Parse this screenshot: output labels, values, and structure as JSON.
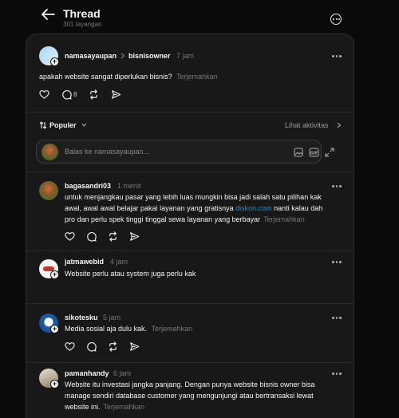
{
  "header": {
    "title": "Thread",
    "views": "301 tayangan"
  },
  "post": {
    "author": "namasayaupan",
    "reply_to": "bisnisowner",
    "time": "7 jam",
    "text": "apakah website sangat diperlukan bisnis?",
    "translate": "Terjemahkan",
    "reply_count": "8"
  },
  "sort": {
    "label": "Populer",
    "activity": "Lihat aktivitas"
  },
  "composer": {
    "placeholder": "Balas ke namasayaupan..."
  },
  "replies": [
    {
      "author": "bagasandri03",
      "time": "1 menit",
      "line1": "untuk menjangkau pasar yang lebih luas mungkin bisa jadi salah satu pilihan kak",
      "line2a": "awal, awal awal belajar pakai layanan yang gratisnya ",
      "link": "diskon.com",
      "line2b": " nanti kalau dah",
      "line3": "pro dan perlu spek tinggi tinggal sewa layanan yang berbayar",
      "translate": "Terjemahkan"
    },
    {
      "author": "jatmawebid",
      "time": "4 jam",
      "text": "Website perlu atau system juga perlu kak"
    },
    {
      "author": "sikotesku",
      "time": "5 jam",
      "text": "Media sosial aja dulu kak.",
      "translate": "Terjemahkan"
    },
    {
      "author": "pamanhandy",
      "time": "6 jam",
      "line1": "Website itu investasi jangka panjang. Dengan punya website bisnis owner bisa",
      "line2": "manage sendiri database customer yang mengunjungi atau bertransaksi lewat",
      "line3": "website ini.",
      "translate": "Terjemahkan"
    }
  ],
  "colors": {
    "background": "#0a0a0a",
    "panel": "#181818",
    "link": "#0095f6",
    "muted": "#777777"
  },
  "icons": [
    "back-arrow-icon",
    "more-circle-icon",
    "heart-icon",
    "comment-icon",
    "repost-icon",
    "share-icon",
    "sort-icon",
    "chevron-down-icon",
    "chevron-right-icon",
    "image-icon",
    "gif-icon",
    "expand-icon",
    "plus-icon"
  ]
}
